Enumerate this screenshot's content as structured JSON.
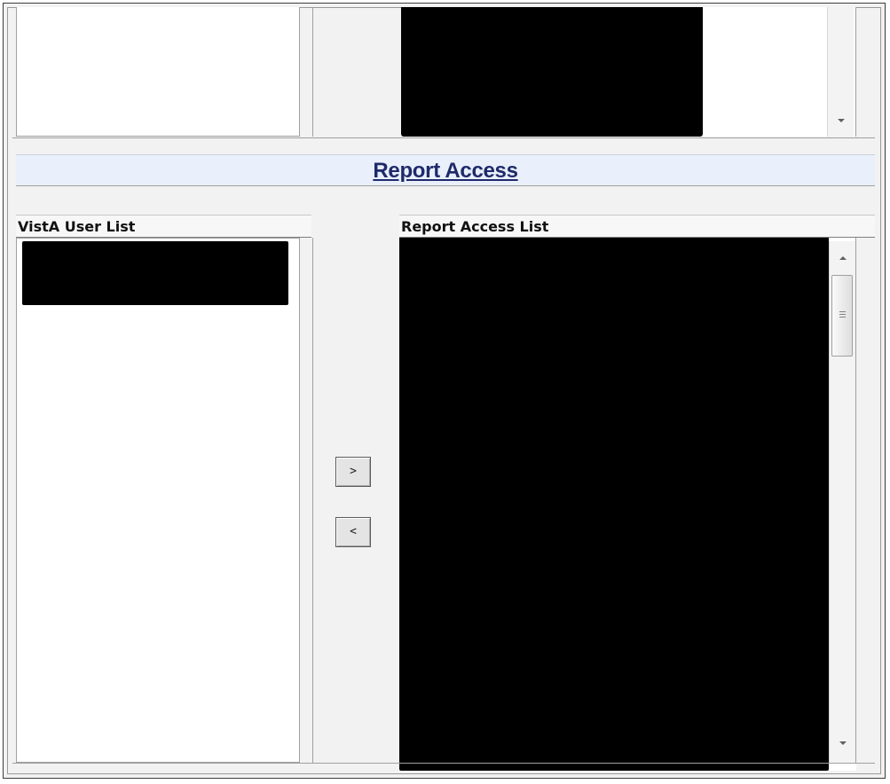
{
  "header": {
    "title": "Report Access"
  },
  "columns": {
    "user_list_label": "VistA User List",
    "access_list_label": "Report Access List"
  },
  "buttons": {
    "add_label": ">",
    "remove_label": "<"
  },
  "icons": {
    "scroll_up": "scroll-up-arrow-icon",
    "scroll_down": "scroll-down-arrow-icon",
    "scroll_grip": "scroll-grip-icon"
  },
  "colors": {
    "title": "#1f2a6b",
    "header_band": "#e9f0fb",
    "panel": "#f2f2f2",
    "redacted": "#000000"
  },
  "redacted_regions": [
    "top-right-list",
    "user-list-selection",
    "report-access-list"
  ]
}
